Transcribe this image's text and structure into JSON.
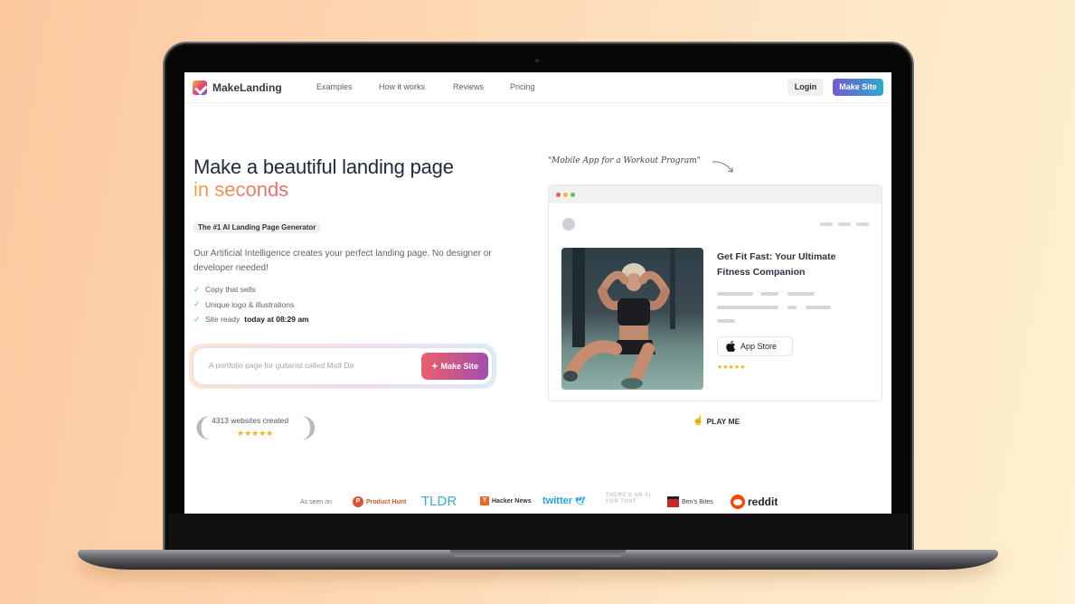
{
  "nav": {
    "brand": "MakeLanding",
    "links": [
      "Examples",
      "How it works",
      "Reviews",
      "Pricing"
    ],
    "login_label": "Login",
    "make_site_label": "Make Site"
  },
  "hero": {
    "title_line1": "Make a beautiful landing page",
    "title_line2": "in seconds",
    "tagline": "The #1 AI Landing Page Generator",
    "description": "Our Artificial Intelligence creates your perfect landing page. No designer or developer needed!",
    "features": [
      {
        "text": "Copy that sells",
        "bold": ""
      },
      {
        "text": "Unique logo & illustrations",
        "bold": ""
      },
      {
        "text": "Site ready ",
        "bold": "today at 08:29 am"
      }
    ],
    "prompt_placeholder": "A portfolio page for guitarist called Matt Da",
    "prompt_button": "Make Site",
    "award_text": "4313 websites created",
    "award_stars": "★★★★★"
  },
  "preview": {
    "quote": "\"Mobile App for a Workout Program\"",
    "title": "Get Fit Fast: Your Ultimate Fitness Companion",
    "app_store_label": "App Store",
    "stars": "★★★★★",
    "play_label": "PLAY ME"
  },
  "seen_on": {
    "label": "As seen on",
    "outlets": [
      "Product Hunt",
      "TLDR",
      "Hacker News",
      "twitter",
      "THERE'S AN AI FOR THAT",
      "Ben's Bites",
      "reddit"
    ]
  },
  "colors": {
    "accent_gradient_start": "#6e5bd6",
    "accent_gradient_end": "#2fa8c9",
    "headline_orange": "#f0a048",
    "headline_pink": "#e66a7a",
    "check_green": "#4cc48a",
    "star_gold": "#f2b21f"
  }
}
